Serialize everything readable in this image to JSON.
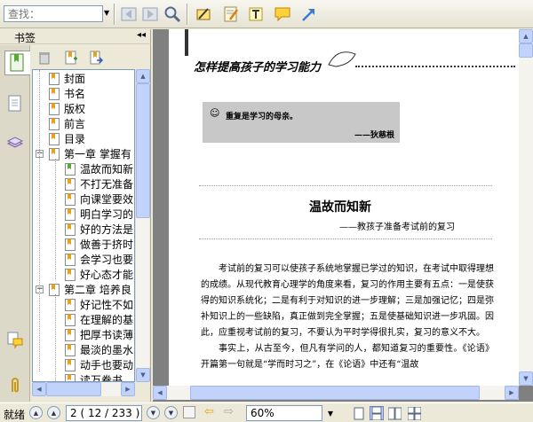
{
  "toolbar": {
    "search_placeholder": "查找：",
    "icons": [
      "prev-page-icon",
      "next-page-icon",
      "search-zoom-icon",
      "select-text-icon",
      "annotate-icon",
      "text-icon",
      "comment-icon",
      "arrow-icon"
    ]
  },
  "left_panel": {
    "title": "书签",
    "collapse_glyph": "◂◂",
    "bookmarks": [
      {
        "label": "封面",
        "level": 0
      },
      {
        "label": "书名",
        "level": 0
      },
      {
        "label": "版权",
        "level": 0
      },
      {
        "label": "前言",
        "level": 0
      },
      {
        "label": "目录",
        "level": 0
      },
      {
        "label": "第一章  掌握有",
        "level": 0,
        "expandable": true
      },
      {
        "label": "温故而知新",
        "level": 1,
        "selected": true
      },
      {
        "label": "不打无准备",
        "level": 1
      },
      {
        "label": "向课堂要效",
        "level": 1
      },
      {
        "label": "明白学习的",
        "level": 1
      },
      {
        "label": "好的方法是",
        "level": 1
      },
      {
        "label": "做善于挤时",
        "level": 1
      },
      {
        "label": "会学习也要",
        "level": 1
      },
      {
        "label": "好心态才能",
        "level": 1
      },
      {
        "label": "第二章  培养良",
        "level": 0,
        "expandable": true
      },
      {
        "label": "好记性不如",
        "level": 1
      },
      {
        "label": "在理解的基",
        "level": 1
      },
      {
        "label": "把厚书读薄",
        "level": 1
      },
      {
        "label": "最淡的墨水",
        "level": 1
      },
      {
        "label": "动手也要动",
        "level": 1
      },
      {
        "label": "读万卷书，",
        "level": 1
      }
    ]
  },
  "document": {
    "running_header": "怎样提高孩子的学习能力",
    "quote": "重复是学习的母亲。",
    "quote_author": "——狄慈根",
    "title": "温故而知新",
    "subtitle": "——教孩子准备考试前的复习",
    "paragraphs": [
      "考试前的复习可以使孩子系统地掌握已学过的知识，在考试中取得理想的成绩。从现代教育心理学的角度来看，复习的作用主要有五点：一是使获得的知识系统化；二是有利于对知识的进一步理解；三是加强记忆；四是弥补知识上的一些缺陷，真正做到完全掌握；五是使基础知识进一步巩固。因此，应重视考试前的复习，不要认为平时学得很扎实，复习的意义不大。",
      "事实上，从古至今，但凡有学问的人，都知道复习的重要性。《论语》开篇第一句就是“学而时习之”，在《论语》中还有“温故"
    ]
  },
  "statusbar": {
    "status": "就绪",
    "page_display": "2 ( 12 / 233 )",
    "zoom": "60%"
  }
}
